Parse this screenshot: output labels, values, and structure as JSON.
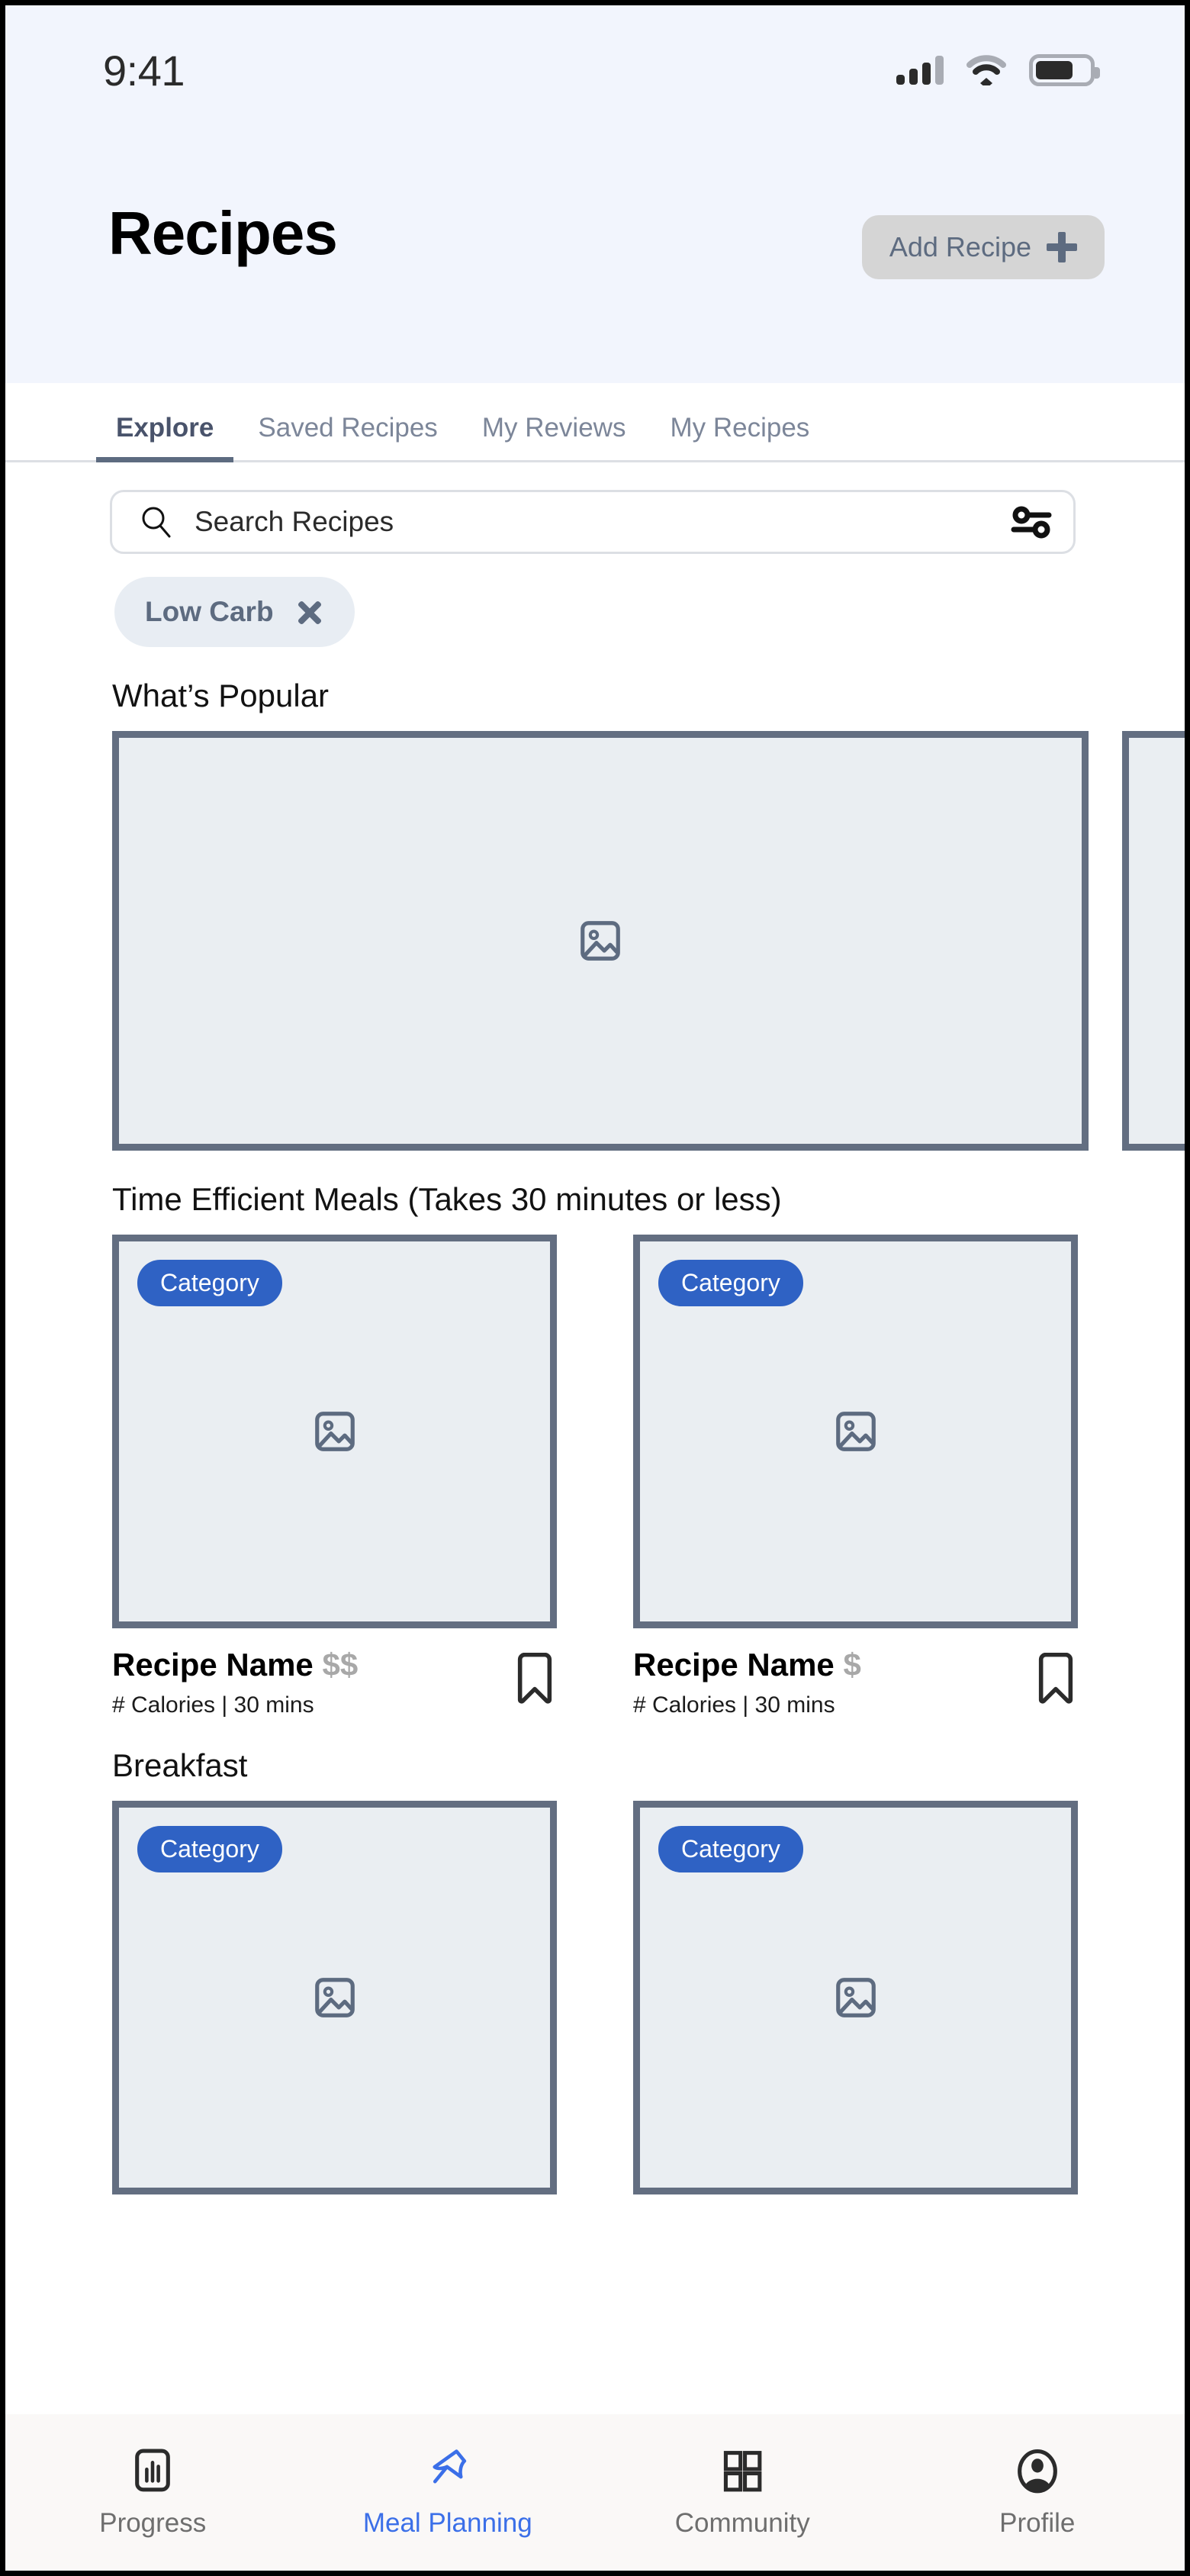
{
  "status_bar": {
    "time": "9:41",
    "signal_icon": "cellular-signal-icon",
    "wifi_icon": "wifi-icon",
    "battery_icon": "battery-icon",
    "battery_level_percent": 70
  },
  "header": {
    "title": "Recipes",
    "add_button_label": "Add Recipe",
    "add_button_icon": "plus-icon",
    "background_color": "#f2f5fd",
    "add_button_bg": "#d5d5d5",
    "add_button_text_color": "#5d6b80"
  },
  "tabs": [
    {
      "label": "Explore",
      "active": true
    },
    {
      "label": "Saved Recipes",
      "active": false
    },
    {
      "label": "My Reviews",
      "active": false
    },
    {
      "label": "My Recipes",
      "active": false
    }
  ],
  "search": {
    "placeholder": "Search Recipes",
    "search_icon": "search-icon",
    "filter_icon": "filter-sliders-icon"
  },
  "filter_chips": [
    {
      "label": "Low Carb",
      "remove_icon": "close-x-icon"
    }
  ],
  "sections": [
    {
      "title": "What’s Popular",
      "layout": "carousel",
      "cards": [
        {
          "image_placeholder_icon": "image-placeholder-icon"
        },
        {
          "image_placeholder_icon": "image-placeholder-icon"
        }
      ]
    },
    {
      "title": "Time Efficient Meals (Takes 30 minutes or less)",
      "layout": "grid",
      "cards": [
        {
          "badge": "Category",
          "name": "Recipe Name",
          "price": "$$",
          "calories": "# Calories",
          "separator": "|",
          "time": "30 mins",
          "bookmark_icon": "bookmark-icon",
          "image_placeholder_icon": "image-placeholder-icon"
        },
        {
          "badge": "Category",
          "name": "Recipe Name",
          "price": "$",
          "calories": "# Calories",
          "separator": "|",
          "time": "30 mins",
          "bookmark_icon": "bookmark-icon",
          "image_placeholder_icon": "image-placeholder-icon"
        }
      ]
    },
    {
      "title": "Breakfast",
      "layout": "grid",
      "cards": [
        {
          "badge": "Category",
          "image_placeholder_icon": "image-placeholder-icon"
        },
        {
          "badge": "Category",
          "image_placeholder_icon": "image-placeholder-icon"
        }
      ]
    }
  ],
  "bottom_nav": {
    "active_color": "#3b6fe8",
    "inactive_color": "#6e6e6e",
    "items": [
      {
        "label": "Progress",
        "icon": "progress-chart-icon",
        "active": false
      },
      {
        "label": "Meal Planning",
        "icon": "meal-pin-icon",
        "active": true
      },
      {
        "label": "Community",
        "icon": "grid-squares-icon",
        "active": false
      },
      {
        "label": "Profile",
        "icon": "person-circle-icon",
        "active": false
      }
    ]
  },
  "colors": {
    "accent_blue": "#2f62c4",
    "nav_active_blue": "#3b6fe8",
    "slate": "#5d6b80",
    "card_border": "#636e81",
    "card_fill": "#eaeef2",
    "price_gray": "#a8a8a8"
  }
}
